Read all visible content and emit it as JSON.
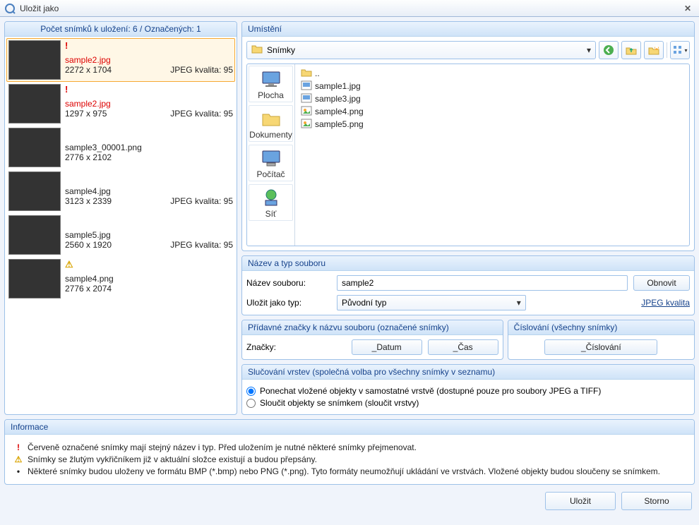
{
  "window": {
    "title": "Uložit jako"
  },
  "snaplist": {
    "header": "Počet snímků k uložení: 6 / Označených: 1",
    "items": [
      {
        "name": "sample2.jpg",
        "dims": "2272 x 1704",
        "quality": "JPEG kvalita: 95",
        "warn": "!",
        "err": true,
        "selected": true,
        "thumb": "th1"
      },
      {
        "name": "sample2.jpg",
        "dims": "1297 x 975",
        "quality": "JPEG kvalita: 95",
        "warn": "!",
        "err": true,
        "selected": false,
        "thumb": "th2"
      },
      {
        "name": "sample3_00001.png",
        "dims": "2776 x 2102",
        "quality": "",
        "warn": "",
        "err": false,
        "selected": false,
        "thumb": "th3"
      },
      {
        "name": "sample4.jpg",
        "dims": "3123 x 2339",
        "quality": "JPEG kvalita: 95",
        "warn": "",
        "err": false,
        "selected": false,
        "thumb": "th4"
      },
      {
        "name": "sample5.jpg",
        "dims": "2560 x 1920",
        "quality": "JPEG kvalita: 95",
        "warn": "",
        "err": false,
        "selected": false,
        "thumb": "th5"
      },
      {
        "name": "sample4.png",
        "dims": "2776 x 2074",
        "quality": "",
        "warn": "⚠",
        "err": false,
        "selected": false,
        "thumb": "th6"
      }
    ]
  },
  "location": {
    "header": "Umístění",
    "path": "Snímky",
    "places": [
      {
        "label": "Plocha",
        "icon": "desktop"
      },
      {
        "label": "Dokumenty",
        "icon": "folder"
      },
      {
        "label": "Počítač",
        "icon": "computer"
      },
      {
        "label": "Síť",
        "icon": "network"
      }
    ],
    "files": [
      {
        "name": "..",
        "icon": "folder"
      },
      {
        "name": "sample1.jpg",
        "icon": "img"
      },
      {
        "name": "sample3.jpg",
        "icon": "img"
      },
      {
        "name": "sample4.png",
        "icon": "img2"
      },
      {
        "name": "sample5.png",
        "icon": "img2"
      }
    ]
  },
  "nametype": {
    "header": "Název a typ souboru",
    "name_label": "Název souboru:",
    "name_value": "sample2",
    "refresh": "Obnovit",
    "type_label": "Uložit jako typ:",
    "type_value": "Původní typ",
    "jpeg_link": "JPEG kvalita"
  },
  "tags": {
    "header": "Přídavné značky k názvu souboru (označené snímky)",
    "label": "Značky:",
    "date_btn": "_Datum",
    "time_btn": "_Čas"
  },
  "numbering": {
    "header": "Číslování (všechny snímky)",
    "btn": "_Číslování"
  },
  "layers": {
    "header": "Slučování vrstev (společná volba pro všechny snímky v seznamu)",
    "opt1": "Ponechat vložené objekty v samostatné vrstvě (dostupné pouze pro soubory JPEG a TIFF)",
    "opt2": "Sloučit objekty se snímkem (sloučit vrstvy)"
  },
  "info": {
    "header": "Informace",
    "items": [
      {
        "icon": "!",
        "color": "#d00",
        "text": "Červeně označené snímky mají stejný název i typ. Před uložením je nutné některé snímky přejmenovat."
      },
      {
        "icon": "⚠",
        "color": "#d9a400",
        "text": "Snímky se žlutým vykřičníkem již v aktuální složce existují a budou přepsány."
      },
      {
        "icon": "•",
        "color": "#222",
        "text": "Některé snímky budou uloženy ve formátu BMP (*.bmp) nebo PNG (*.png). Tyto formáty neumožňují ukládání ve vrstvách. Vložené objekty budou sloučeny se snímkem."
      }
    ]
  },
  "buttons": {
    "save": "Uložit",
    "cancel": "Storno"
  }
}
